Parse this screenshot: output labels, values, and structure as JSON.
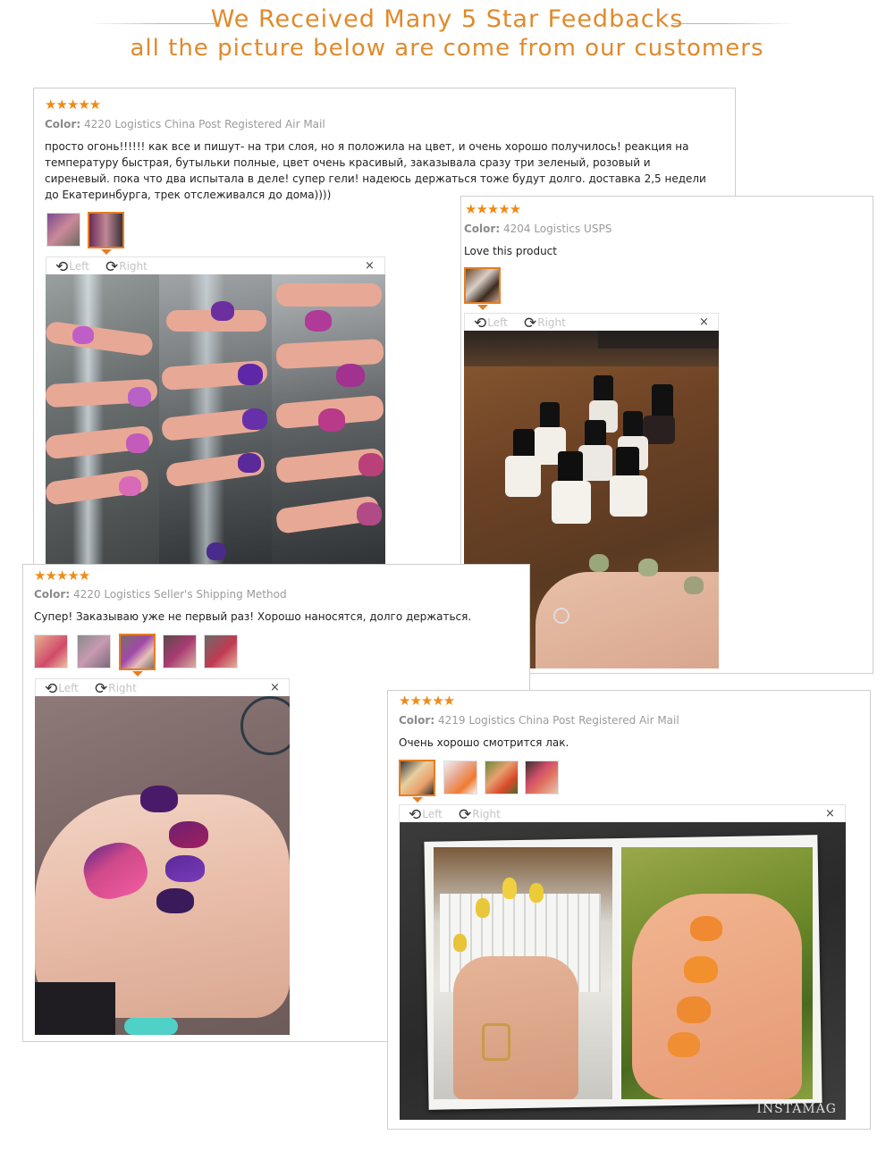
{
  "header": {
    "title": "We Received Many 5 Star Feedbacks",
    "subtitle": "all the picture below are come from our customers"
  },
  "viewer": {
    "left_label": "Left",
    "right_label": "Right",
    "close": "×"
  },
  "reviews": [
    {
      "stars": "★★★★★",
      "color_label": "Color:",
      "color_value": "4220",
      "logistics": "Logistics China Post Registered Air Mail",
      "text": "просто огонь!!!!!! как все и пишут- на три слоя, но я положила на цвет, и очень хорошо получилось! реакция на температуру быстрая, бутыльки полные, цвет очень красивый, заказывала сразу три зеленый, розовый и сиреневый. пока что два испытала в деле! супер гели! надеюсь держаться тоже будут долго. доставка 2,5 недели до Екатеринбурга, трек отслеживался до дома))))"
    },
    {
      "stars": "★★★★★",
      "color_label": "Color:",
      "color_value": "4204",
      "logistics": "Logistics USPS",
      "text": "Love this product"
    },
    {
      "stars": "★★★★★",
      "color_label": "Color:",
      "color_value": "4220",
      "logistics": "Logistics Seller's Shipping Method",
      "text": "Супер! Заказываю уже не первый раз! Хорошо наносятся, долго держаться."
    },
    {
      "stars": "★★★★★",
      "color_label": "Color:",
      "color_value": "4219",
      "logistics": "Logistics China Post Registered Air Mail",
      "text": "Очень хорошо смотрится лак.",
      "watermark": "INSTAMAG"
    }
  ]
}
